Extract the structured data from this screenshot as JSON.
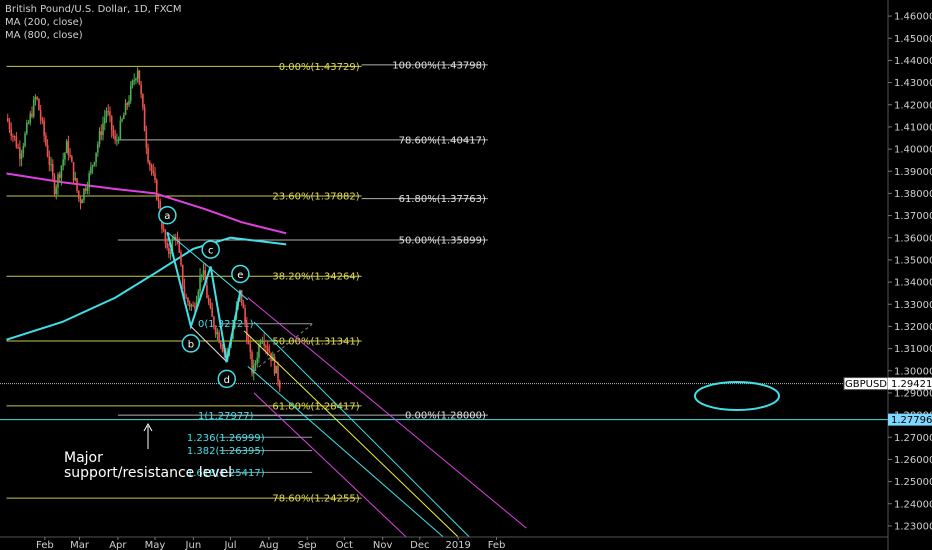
{
  "legend": {
    "title": "British Pound/U.S. Dollar, 1D, FXCM",
    "ma1": "MA (200, close)",
    "ma2": "MA (800, close)"
  },
  "annotation": {
    "line1": "Major",
    "line2": "support/resistance level"
  },
  "colors": {
    "background": "#000000",
    "fib": "#c8c84a",
    "fib_text": "#e0dc50",
    "white_level": "#b0b0b0",
    "cyan": "#40e0e8",
    "magenta": "#e040e0",
    "yellow": "#f0f040",
    "up_candle": "#4caf50",
    "down_candle": "#ef5350",
    "ma200": "#40e0e8",
    "ma800": "#e040e0",
    "price_badge": "#ffffff",
    "level_badge": "#7fd8ff"
  },
  "chart_data": {
    "type": "candlestick",
    "symbol": "GBPUSD",
    "ylim": [
      1.225,
      1.465
    ],
    "y_ticks": [
      "1.46000",
      "1.45000",
      "1.44000",
      "1.43000",
      "1.42000",
      "1.41000",
      "1.40000",
      "1.39000",
      "1.38000",
      "1.37000",
      "1.36000",
      "1.35000",
      "1.34000",
      "1.33000",
      "1.32000",
      "1.31000",
      "1.30000",
      "1.29000",
      "1.28000",
      "1.27000",
      "1.26000",
      "1.25000",
      "1.24000",
      "1.23000"
    ],
    "x_ticks": [
      {
        "label": "Feb",
        "date": "2018-02-01"
      },
      {
        "label": "Mar",
        "date": "2018-03-01"
      },
      {
        "label": "Apr",
        "date": "2018-04-01"
      },
      {
        "label": "May",
        "date": "2018-05-01"
      },
      {
        "label": "Jun",
        "date": "2018-06-01"
      },
      {
        "label": "Jul",
        "date": "2018-07-01"
      },
      {
        "label": "Aug",
        "date": "2018-08-01"
      },
      {
        "label": "Sep",
        "date": "2018-09-01"
      },
      {
        "label": "Oct",
        "date": "2018-10-01"
      },
      {
        "label": "Nov",
        "date": "2018-11-01"
      },
      {
        "label": "Dec",
        "date": "2018-12-01"
      },
      {
        "label": "2019",
        "date": "2019-01-01"
      },
      {
        "label": "Feb",
        "date": "2019-02-01"
      }
    ],
    "price_path": [
      {
        "date": "2018-01-01",
        "value": 1.414
      },
      {
        "date": "2018-01-12",
        "value": 1.398
      },
      {
        "date": "2018-01-25",
        "value": 1.424
      },
      {
        "date": "2018-02-09",
        "value": 1.382
      },
      {
        "date": "2018-02-19",
        "value": 1.402
      },
      {
        "date": "2018-03-01",
        "value": 1.376
      },
      {
        "date": "2018-03-09",
        "value": 1.388
      },
      {
        "date": "2018-03-23",
        "value": 1.418
      },
      {
        "date": "2018-03-30",
        "value": 1.402
      },
      {
        "date": "2018-04-17",
        "value": 1.437
      },
      {
        "date": "2018-04-25",
        "value": 1.398
      },
      {
        "date": "2018-05-02",
        "value": 1.381
      },
      {
        "date": "2018-05-11",
        "value": 1.352
      },
      {
        "date": "2018-05-18",
        "value": 1.362
      },
      {
        "date": "2018-05-25",
        "value": 1.333
      },
      {
        "date": "2018-06-01",
        "value": 1.328
      },
      {
        "date": "2018-06-08",
        "value": 1.346
      },
      {
        "date": "2018-06-15",
        "value": 1.325
      },
      {
        "date": "2018-06-28",
        "value": 1.306
      },
      {
        "date": "2018-07-09",
        "value": 1.336
      },
      {
        "date": "2018-07-19",
        "value": 1.298
      },
      {
        "date": "2018-07-26",
        "value": 1.317
      },
      {
        "date": "2018-08-02",
        "value": 1.308
      },
      {
        "date": "2018-08-10",
        "value": 1.294
      }
    ],
    "ma_200": [
      {
        "date": "2018-01-01",
        "value": 1.314
      },
      {
        "date": "2018-02-15",
        "value": 1.322
      },
      {
        "date": "2018-03-30",
        "value": 1.333
      },
      {
        "date": "2018-05-01",
        "value": 1.344
      },
      {
        "date": "2018-06-01",
        "value": 1.355
      },
      {
        "date": "2018-07-01",
        "value": 1.36
      },
      {
        "date": "2018-08-15",
        "value": 1.357
      }
    ],
    "ma_800": [
      {
        "date": "2018-01-01",
        "value": 1.389
      },
      {
        "date": "2018-02-15",
        "value": 1.385
      },
      {
        "date": "2018-03-30",
        "value": 1.382
      },
      {
        "date": "2018-05-01",
        "value": 1.38
      },
      {
        "date": "2018-06-10",
        "value": 1.373
      },
      {
        "date": "2018-07-10",
        "value": 1.367
      },
      {
        "date": "2018-08-15",
        "value": 1.362
      }
    ],
    "wave_points": [
      {
        "label": "a",
        "date": "2018-05-11",
        "value": 1.3625
      },
      {
        "label": "b",
        "date": "2018-05-30",
        "value": 1.32
      },
      {
        "label": "c",
        "date": "2018-06-15",
        "value": 1.347
      },
      {
        "label": "d",
        "date": "2018-06-28",
        "value": 1.304
      },
      {
        "label": "e",
        "date": "2018-07-09",
        "value": 1.336
      }
    ],
    "fib_levels": [
      {
        "value": 1.43729,
        "label": "0.00%(1.43729)",
        "from": "2018-01-01",
        "to": "2018-10-15",
        "style": "fib"
      },
      {
        "value": 1.43798,
        "label": "100.00%(1.43798)",
        "from": "2018-10-15",
        "to": "2019-01-25",
        "style": "white"
      },
      {
        "value": 1.40417,
        "label": "78.60%(1.40417)",
        "from": "2018-04-01",
        "to": "2019-01-25",
        "style": "white"
      },
      {
        "value": 1.37882,
        "label": "23.60%(1.37882)",
        "from": "2018-01-01",
        "to": "2018-10-15",
        "style": "fib"
      },
      {
        "value": 1.37763,
        "label": "61.80%(1.37763)",
        "from": "2018-10-15",
        "to": "2019-01-25",
        "style": "white"
      },
      {
        "value": 1.35899,
        "label": "50.00%(1.35899)",
        "from": "2018-04-01",
        "to": "2019-01-25",
        "style": "white"
      },
      {
        "value": 1.34264,
        "label": "38.20%(1.34264)",
        "from": "2018-01-01",
        "to": "2018-10-15",
        "style": "fib"
      },
      {
        "value": 1.31341,
        "label": "50.00%(1.31341)",
        "from": "2018-01-01",
        "to": "2018-10-15",
        "style": "fib"
      },
      {
        "value": 1.28417,
        "label": "61.80%(1.28417)",
        "from": "2018-01-01",
        "to": "2018-10-15",
        "style": "fib"
      },
      {
        "value": 1.28,
        "label": "0.00%(1.28000)",
        "from": "2018-04-01",
        "to": "2019-01-25",
        "style": "white"
      },
      {
        "value": 1.24255,
        "label": "78.60%(1.24255)",
        "from": "2018-01-01",
        "to": "2018-10-15",
        "style": "fib"
      }
    ],
    "extension_levels": [
      {
        "value": 1.32121,
        "label": "0(1.32121)",
        "from": "2018-06-22",
        "to": "2018-09-05"
      },
      {
        "value": 1.27977,
        "label": "1(1.27977)",
        "from": "2018-06-22",
        "to": "2018-09-05"
      },
      {
        "value": 1.26999,
        "label": "1.236(1.26999)",
        "from": "2018-06-22",
        "to": "2018-09-05"
      },
      {
        "value": 1.26395,
        "label": "1.382(1.26395)",
        "from": "2018-06-22",
        "to": "2018-09-05"
      },
      {
        "value": 1.25417,
        "label": "1.618(1.25417)",
        "from": "2018-06-22",
        "to": "2018-09-05"
      }
    ],
    "major_level": {
      "value": 1.27796,
      "label": "1.27796"
    },
    "current_price": {
      "value": 1.29421,
      "symbol": "GBPUSD",
      "label": "1.29421"
    },
    "channels": [
      {
        "color": "cyan",
        "from": {
          "date": "2018-05-11",
          "value": 1.3625
        },
        "to": {
          "date": "2018-07-15",
          "value": 1.332
        }
      },
      {
        "color": "white",
        "from": {
          "date": "2018-05-30",
          "value": 1.32
        },
        "to": {
          "date": "2018-06-28",
          "value": 1.304
        }
      },
      {
        "color": "magenta",
        "from": {
          "date": "2018-07-15",
          "value": 1.333
        },
        "to": {
          "date": "2019-02-25",
          "value": 1.229
        }
      },
      {
        "color": "cyan",
        "from": {
          "date": "2018-07-20",
          "value": 1.322
        },
        "to": {
          "date": "2019-01-10",
          "value": 1.225
        }
      },
      {
        "color": "yellow",
        "from": {
          "date": "2018-07-12",
          "value": 1.318
        },
        "to": {
          "date": "2019-01-01",
          "value": 1.225
        }
      },
      {
        "color": "cyan",
        "from": {
          "date": "2018-07-15",
          "value": 1.302
        },
        "to": {
          "date": "2018-12-20",
          "value": 1.225
        }
      },
      {
        "color": "magenta",
        "from": {
          "date": "2018-07-20",
          "value": 1.29
        },
        "to": {
          "date": "2018-11-20",
          "value": 1.225
        }
      }
    ]
  }
}
